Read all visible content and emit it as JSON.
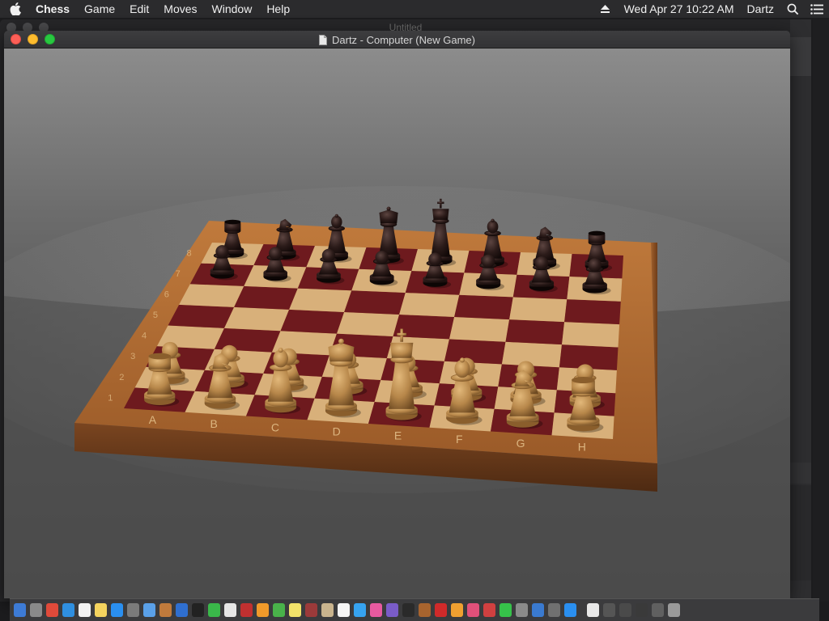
{
  "menubar": {
    "app_name": "Chess",
    "items": [
      "Game",
      "Edit",
      "Moves",
      "Window",
      "Help"
    ],
    "datetime": "Wed Apr 27  10:22 AM",
    "user": "Dartz"
  },
  "background_window": {
    "title": "Untitled"
  },
  "chess_window": {
    "title": "Dartz - Computer   (New Game)"
  },
  "board": {
    "files": [
      "A",
      "B",
      "C",
      "D",
      "E",
      "F",
      "G",
      "H"
    ],
    "ranks": [
      "1",
      "2",
      "3",
      "4",
      "5",
      "6",
      "7",
      "8"
    ],
    "white_back_rank": [
      "rook",
      "knight",
      "bishop",
      "queen",
      "king",
      "bishop",
      "knight",
      "rook"
    ],
    "black_back_rank": [
      "rook",
      "knight",
      "bishop",
      "queen",
      "king",
      "bishop",
      "knight",
      "rook"
    ],
    "pawns_per_side": 8,
    "light_square_color": "#d8b07a",
    "dark_square_color": "#6e1a1e",
    "frame_color": "#a8642e",
    "white_piece_color": "#b98a4e",
    "black_piece_color": "#2a1a18"
  },
  "dock": {
    "icons": [
      "finder-icon",
      "launchpad-icon",
      "chrome-icon",
      "safari-icon",
      "calendar-icon",
      "notes-icon",
      "app-store-icon",
      "system-preferences-icon",
      "preview-icon",
      "books-icon",
      "keynote-icon",
      "terminal-icon",
      "facetime-icon",
      "text-edit-icon",
      "photo-booth-icon",
      "pages-icon",
      "numbers-icon",
      "stickies-icon",
      "dictionary-icon",
      "contacts-icon",
      "reminders-icon",
      "messages-icon",
      "itunes-icon",
      "game-center-icon",
      "activity-monitor-icon",
      "chess-icon",
      "no-entry-icon",
      "home-icon",
      "photos-icon",
      "puzzle-icon",
      "facetime-2-icon",
      "automator-icon",
      "iphoto-icon",
      "migration-icon",
      "app-store-2-icon",
      "document-icon",
      "window-icon",
      "folder-icon",
      "screen-icon",
      "downloads-icon",
      "trash-icon"
    ]
  }
}
